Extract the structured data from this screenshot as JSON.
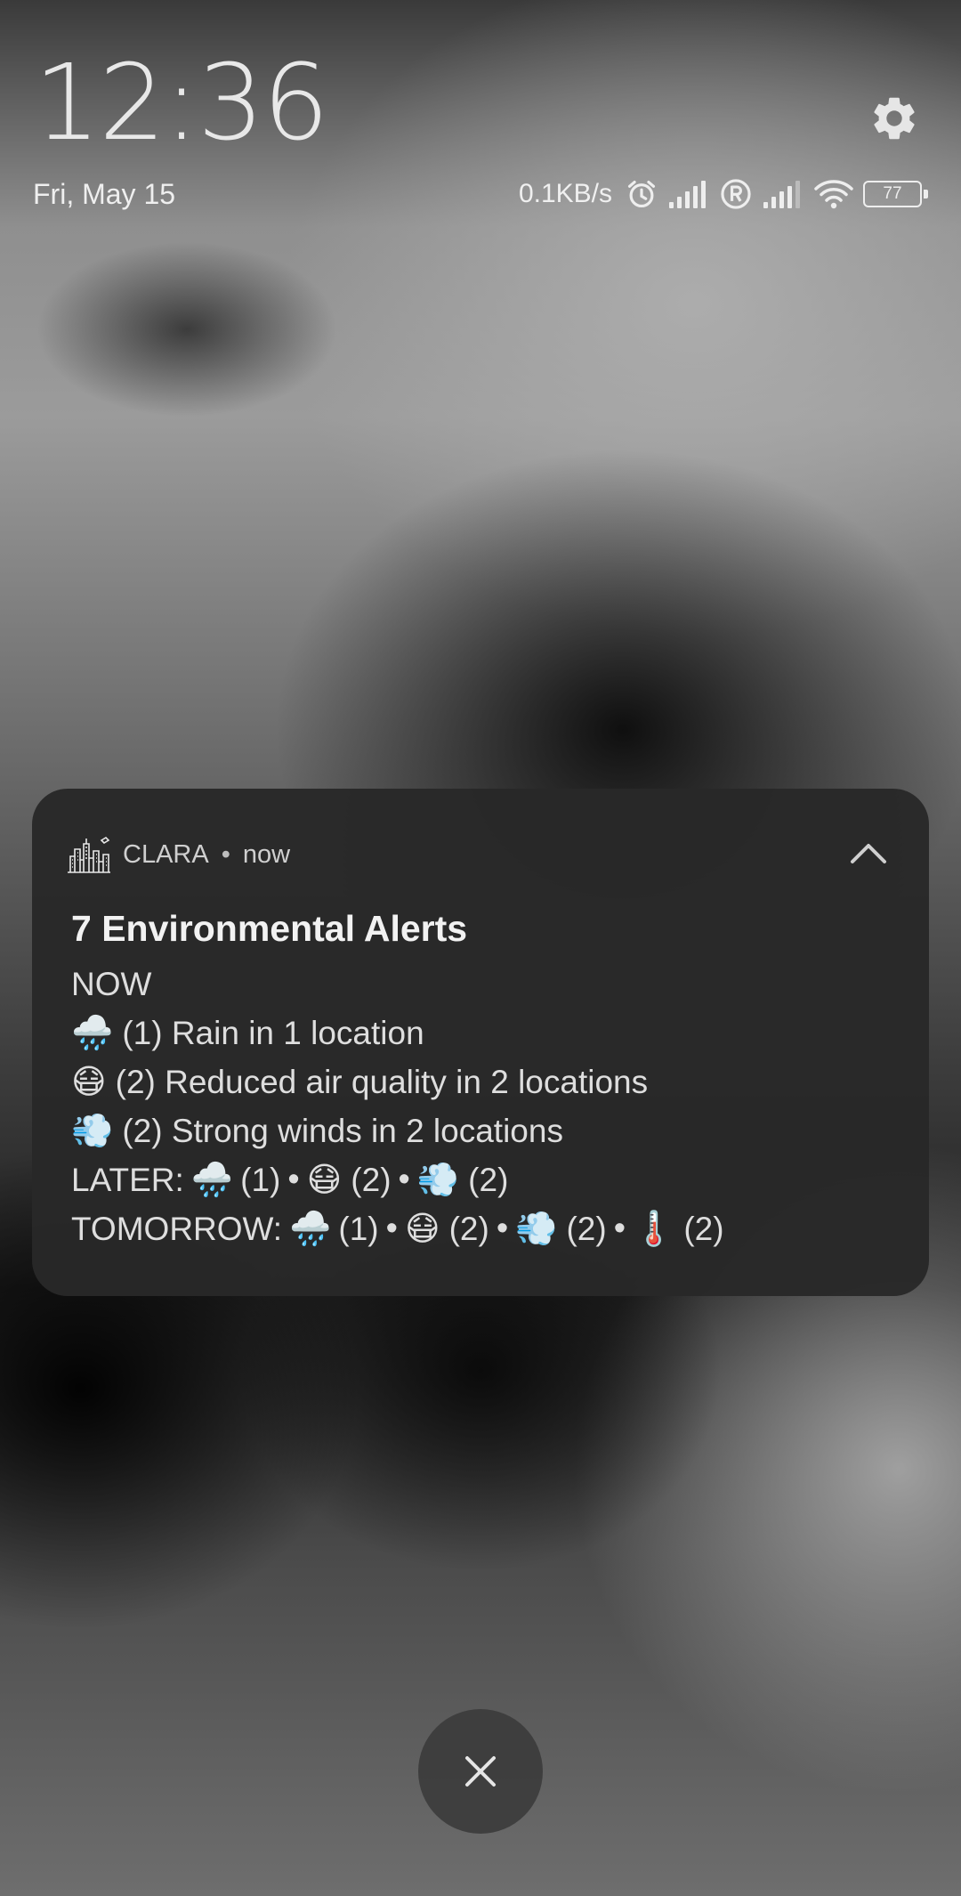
{
  "lockscreen": {
    "time": "12:36",
    "date": "Fri, May 15"
  },
  "status_bar": {
    "network_speed": "0.1KB/s",
    "battery_level": "77",
    "icons": [
      "alarm-icon",
      "signal-icon",
      "roaming-icon",
      "signal-icon",
      "wifi-icon",
      "battery-icon",
      "gear-icon"
    ]
  },
  "notification": {
    "app_name": "CLARA",
    "separator": "•",
    "time_ago": "now",
    "title": "7 Environmental Alerts",
    "section_now": "NOW",
    "now_items": [
      {
        "emoji": "🌧️",
        "text": "(1) Rain in 1 location"
      },
      {
        "emoji": "😷",
        "text": "(2) Reduced air quality in 2 locations"
      },
      {
        "emoji": "💨",
        "text": "(2) Strong winds in 2 locations"
      }
    ],
    "later": {
      "label": "LATER:",
      "rain_emoji": "🌧️",
      "rain_count": "(1)",
      "air_emoji": "😷",
      "air_count": "(2)",
      "wind_emoji": "💨",
      "wind_count": "(2)",
      "dot": "•"
    },
    "tomorrow": {
      "label": "TOMORROW:",
      "rain_emoji": "🌧️",
      "rain_count": "(1)",
      "air_emoji": "😷",
      "air_count": "(2)",
      "wind_emoji": "💨",
      "wind_count": "(2)",
      "temp_emoji": "🌡️",
      "temp_count": "(2)",
      "dot": "•"
    }
  }
}
